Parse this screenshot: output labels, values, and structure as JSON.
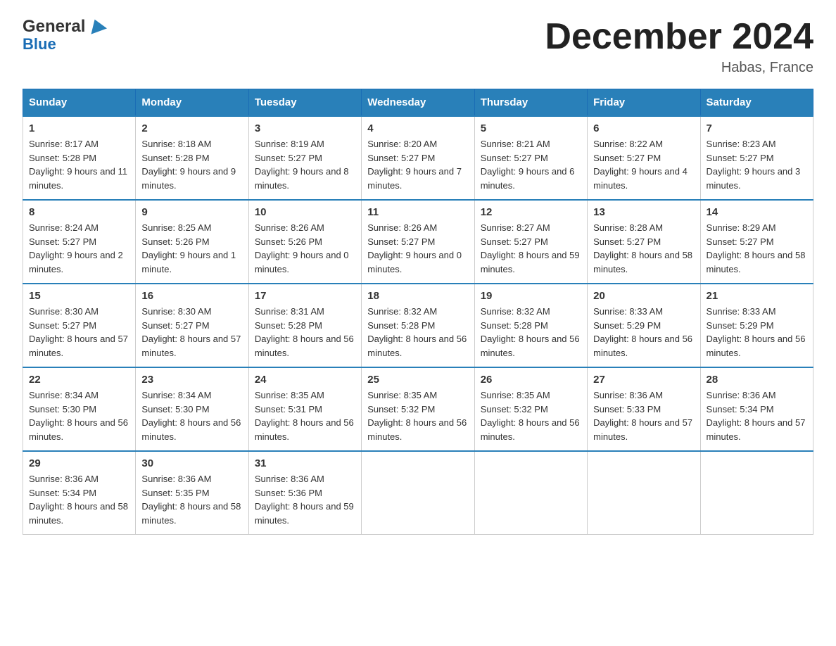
{
  "header": {
    "logo_general": "General",
    "logo_blue": "Blue",
    "title": "December 2024",
    "location": "Habas, France"
  },
  "days_of_week": [
    "Sunday",
    "Monday",
    "Tuesday",
    "Wednesday",
    "Thursday",
    "Friday",
    "Saturday"
  ],
  "weeks": [
    [
      {
        "day": "1",
        "sunrise": "8:17 AM",
        "sunset": "5:28 PM",
        "daylight": "9 hours and 11 minutes."
      },
      {
        "day": "2",
        "sunrise": "8:18 AM",
        "sunset": "5:28 PM",
        "daylight": "9 hours and 9 minutes."
      },
      {
        "day": "3",
        "sunrise": "8:19 AM",
        "sunset": "5:27 PM",
        "daylight": "9 hours and 8 minutes."
      },
      {
        "day": "4",
        "sunrise": "8:20 AM",
        "sunset": "5:27 PM",
        "daylight": "9 hours and 7 minutes."
      },
      {
        "day": "5",
        "sunrise": "8:21 AM",
        "sunset": "5:27 PM",
        "daylight": "9 hours and 6 minutes."
      },
      {
        "day": "6",
        "sunrise": "8:22 AM",
        "sunset": "5:27 PM",
        "daylight": "9 hours and 4 minutes."
      },
      {
        "day": "7",
        "sunrise": "8:23 AM",
        "sunset": "5:27 PM",
        "daylight": "9 hours and 3 minutes."
      }
    ],
    [
      {
        "day": "8",
        "sunrise": "8:24 AM",
        "sunset": "5:27 PM",
        "daylight": "9 hours and 2 minutes."
      },
      {
        "day": "9",
        "sunrise": "8:25 AM",
        "sunset": "5:26 PM",
        "daylight": "9 hours and 1 minute."
      },
      {
        "day": "10",
        "sunrise": "8:26 AM",
        "sunset": "5:26 PM",
        "daylight": "9 hours and 0 minutes."
      },
      {
        "day": "11",
        "sunrise": "8:26 AM",
        "sunset": "5:27 PM",
        "daylight": "9 hours and 0 minutes."
      },
      {
        "day": "12",
        "sunrise": "8:27 AM",
        "sunset": "5:27 PM",
        "daylight": "8 hours and 59 minutes."
      },
      {
        "day": "13",
        "sunrise": "8:28 AM",
        "sunset": "5:27 PM",
        "daylight": "8 hours and 58 minutes."
      },
      {
        "day": "14",
        "sunrise": "8:29 AM",
        "sunset": "5:27 PM",
        "daylight": "8 hours and 58 minutes."
      }
    ],
    [
      {
        "day": "15",
        "sunrise": "8:30 AM",
        "sunset": "5:27 PM",
        "daylight": "8 hours and 57 minutes."
      },
      {
        "day": "16",
        "sunrise": "8:30 AM",
        "sunset": "5:27 PM",
        "daylight": "8 hours and 57 minutes."
      },
      {
        "day": "17",
        "sunrise": "8:31 AM",
        "sunset": "5:28 PM",
        "daylight": "8 hours and 56 minutes."
      },
      {
        "day": "18",
        "sunrise": "8:32 AM",
        "sunset": "5:28 PM",
        "daylight": "8 hours and 56 minutes."
      },
      {
        "day": "19",
        "sunrise": "8:32 AM",
        "sunset": "5:28 PM",
        "daylight": "8 hours and 56 minutes."
      },
      {
        "day": "20",
        "sunrise": "8:33 AM",
        "sunset": "5:29 PM",
        "daylight": "8 hours and 56 minutes."
      },
      {
        "day": "21",
        "sunrise": "8:33 AM",
        "sunset": "5:29 PM",
        "daylight": "8 hours and 56 minutes."
      }
    ],
    [
      {
        "day": "22",
        "sunrise": "8:34 AM",
        "sunset": "5:30 PM",
        "daylight": "8 hours and 56 minutes."
      },
      {
        "day": "23",
        "sunrise": "8:34 AM",
        "sunset": "5:30 PM",
        "daylight": "8 hours and 56 minutes."
      },
      {
        "day": "24",
        "sunrise": "8:35 AM",
        "sunset": "5:31 PM",
        "daylight": "8 hours and 56 minutes."
      },
      {
        "day": "25",
        "sunrise": "8:35 AM",
        "sunset": "5:32 PM",
        "daylight": "8 hours and 56 minutes."
      },
      {
        "day": "26",
        "sunrise": "8:35 AM",
        "sunset": "5:32 PM",
        "daylight": "8 hours and 56 minutes."
      },
      {
        "day": "27",
        "sunrise": "8:36 AM",
        "sunset": "5:33 PM",
        "daylight": "8 hours and 57 minutes."
      },
      {
        "day": "28",
        "sunrise": "8:36 AM",
        "sunset": "5:34 PM",
        "daylight": "8 hours and 57 minutes."
      }
    ],
    [
      {
        "day": "29",
        "sunrise": "8:36 AM",
        "sunset": "5:34 PM",
        "daylight": "8 hours and 58 minutes."
      },
      {
        "day": "30",
        "sunrise": "8:36 AM",
        "sunset": "5:35 PM",
        "daylight": "8 hours and 58 minutes."
      },
      {
        "day": "31",
        "sunrise": "8:36 AM",
        "sunset": "5:36 PM",
        "daylight": "8 hours and 59 minutes."
      },
      null,
      null,
      null,
      null
    ]
  ],
  "labels": {
    "sunrise": "Sunrise:",
    "sunset": "Sunset:",
    "daylight": "Daylight:"
  }
}
